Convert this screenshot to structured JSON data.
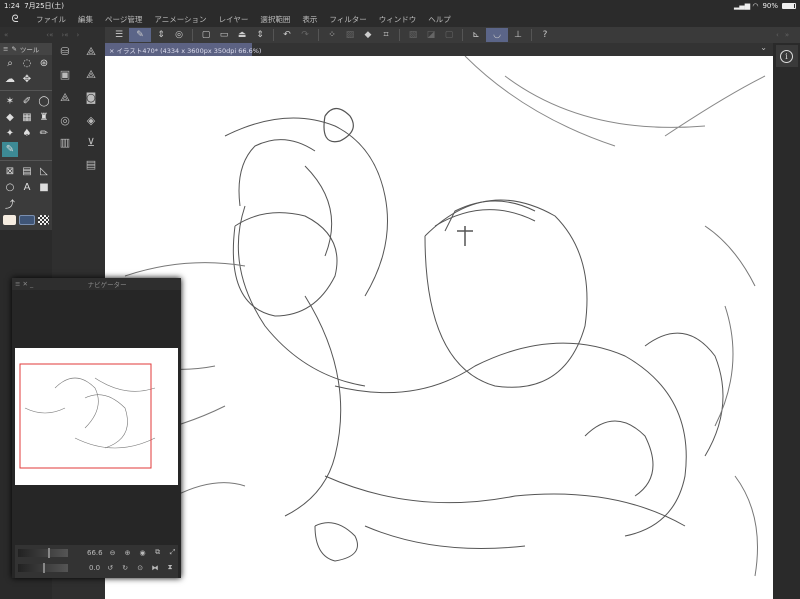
{
  "status": {
    "time": "1:24",
    "date": "7月25日(土)",
    "battery": "90%"
  },
  "menu": {
    "items": [
      "ファイル",
      "編集",
      "ページ管理",
      "アニメーション",
      "レイヤー",
      "選択範囲",
      "表示",
      "フィルター",
      "ウィンドウ",
      "ヘルプ"
    ]
  },
  "tools": {
    "header": "ツール"
  },
  "document": {
    "tab_label": "イラスト470* (4334 x 3600px 350dpi 66.6%)"
  },
  "navigator": {
    "title": "ナビゲーター",
    "zoom": "66.6",
    "rotation": "0.0"
  },
  "colors": {
    "accent": "#5b6588",
    "selected_tool": "#3d8a95",
    "frame": "#e23a3a"
  }
}
